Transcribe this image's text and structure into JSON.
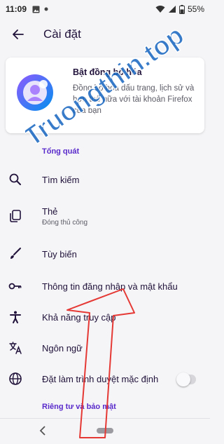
{
  "status_bar": {
    "time": "11:09",
    "battery": "55%"
  },
  "header": {
    "title": "Cài đặt"
  },
  "sync_card": {
    "title": "Bật đồng bộ hóa",
    "description": "Đồng bộ hóa dấu trang, lịch sử và hơn thế nữa với tài khoản Firefox của bạn"
  },
  "sections": {
    "general": "Tổng quát",
    "privacy": "Riêng tư và bảo mật"
  },
  "items": {
    "search": "Tìm kiếm",
    "tabs": "Thẻ",
    "tabs_sub": "Đóng thủ công",
    "customize": "Tùy biến",
    "logins": "Thông tin đăng nhập và mật khẩu",
    "accessibility": "Khả năng truy cập",
    "language": "Ngôn ngữ",
    "default_browser": "Đặt làm trình duyệt mặc định"
  },
  "watermark": "Truongthin.top",
  "colors": {
    "accent": "#592acb",
    "watermark": "#1565c0",
    "arrow": "#e53935"
  }
}
